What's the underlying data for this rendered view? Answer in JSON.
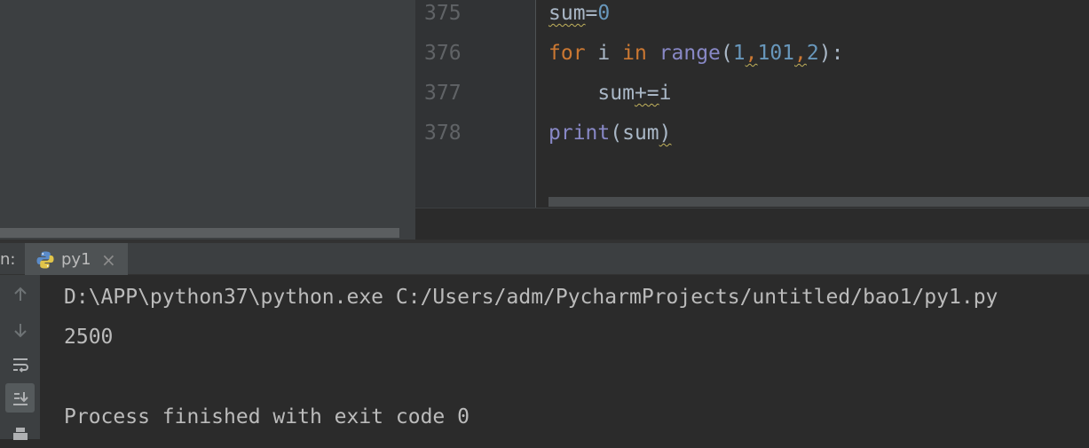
{
  "editor": {
    "line_numbers": [
      "375",
      "376",
      "377",
      "378"
    ],
    "lines": {
      "l1": {
        "var": "sum",
        "op": "=",
        "val": "0"
      },
      "l2": {
        "kw_for": "for",
        "var": " i ",
        "kw_in": "in",
        "fn": "range",
        "open": "(",
        "a": "1",
        "c1": ",",
        "b": "101",
        "c2": ",",
        "c": "2",
        "close": "):"
      },
      "l3": {
        "indent": "    ",
        "var": "sum",
        "op": "+=",
        "val": "i"
      },
      "l4": {
        "fn": "print",
        "open": "(",
        "arg": "sum",
        "close": ")"
      }
    }
  },
  "run_panel": {
    "label_prefix": "n:",
    "tab_label": "py1",
    "tab_close": "×"
  },
  "console": {
    "command": "D:\\APP\\python37\\python.exe C:/Users/adm/PycharmProjects/untitled/bao1/py1.py",
    "output": "2500",
    "exit_message": "Process finished with exit code 0"
  },
  "icons": {
    "tab": "python-icon",
    "tools": [
      "up-arrow-icon",
      "down-arrow-icon",
      "soft-wrap-icon",
      "scroll-to-end-icon",
      "print-icon"
    ]
  },
  "colors": {
    "keyword": "#cc7832",
    "builtin": "#8888c6",
    "number": "#6897bb",
    "identifier": "#a9b7c6",
    "console_text": "#bbbbbb"
  }
}
